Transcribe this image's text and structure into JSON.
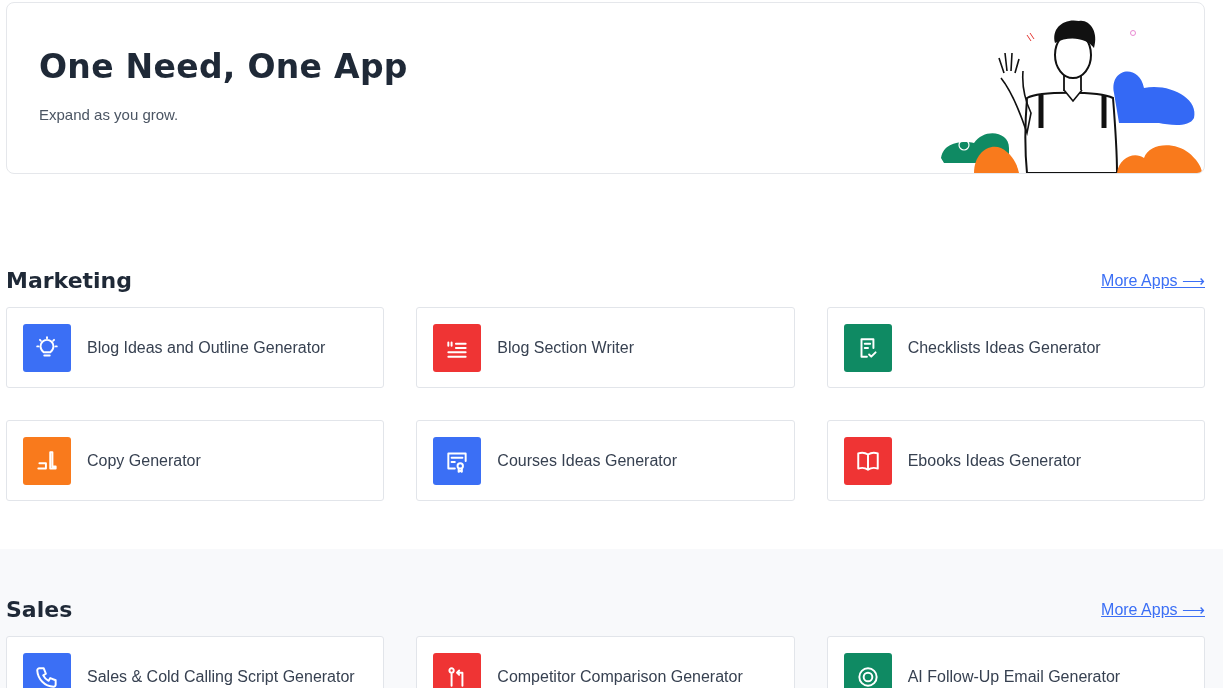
{
  "hero": {
    "title": "One Need, One App",
    "subtitle": "Expand as you grow."
  },
  "sections": [
    {
      "title": "Marketing",
      "link": "More Apps ⟶",
      "shaded": false,
      "apps": [
        {
          "name": "Blog Ideas and Outline Generator",
          "kind": "bulb",
          "color": "#3b6ff5"
        },
        {
          "name": "Blog Section Writer",
          "kind": "quote",
          "color": "#ef3434"
        },
        {
          "name": "Checklists Ideas Generator",
          "kind": "checklist",
          "color": "#0f8a63"
        },
        {
          "name": "Copy Generator",
          "kind": "pencil",
          "color": "#f97a1c"
        },
        {
          "name": "Courses Ideas Generator",
          "kind": "certificate",
          "color": "#3b6ff5"
        },
        {
          "name": "Ebooks Ideas Generator",
          "kind": "book",
          "color": "#ef3434"
        }
      ]
    },
    {
      "title": "Sales",
      "link": "More Apps ⟶",
      "shaded": true,
      "apps": [
        {
          "name": "Sales & Cold Calling Script Generator",
          "kind": "phone",
          "color": "#3b6ff5"
        },
        {
          "name": "Competitor Comparison Generator",
          "kind": "compare",
          "color": "#ef3434"
        },
        {
          "name": "AI Follow-Up Email Generator",
          "kind": "target",
          "color": "#0f8a63"
        }
      ]
    }
  ]
}
